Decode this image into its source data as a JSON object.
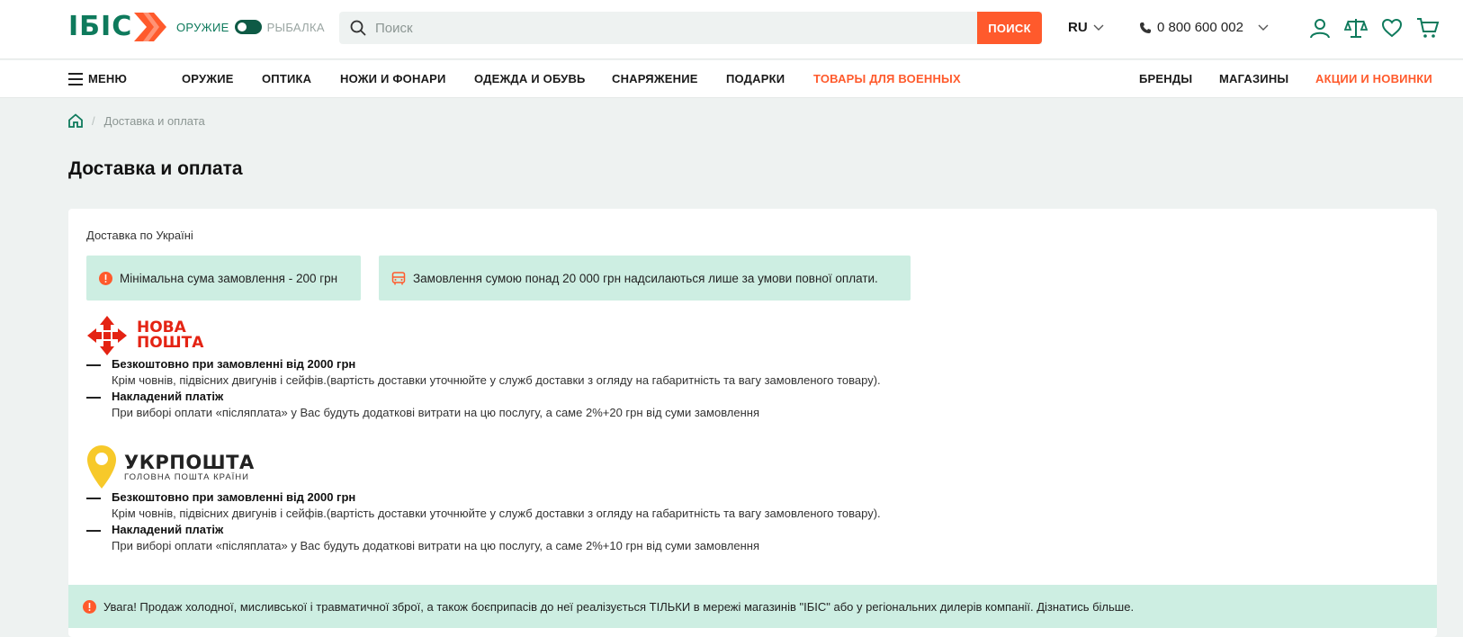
{
  "header": {
    "logo_text": "ІБІС",
    "switch_left": "ОРУЖИЕ",
    "switch_right": "РЫБАЛКА",
    "search_placeholder": "Поиск",
    "search_button": "ПОИСК",
    "language": "RU",
    "phone": "0 800 600 002",
    "accent_color": "#ff5a2c",
    "brand_color": "#0e7a5c"
  },
  "nav": {
    "menu": "МЕНЮ",
    "items": [
      "ОРУЖИЕ",
      "ОПТИКА",
      "НОЖИ И ФОНАРИ",
      "ОДЕЖДА И ОБУВЬ",
      "СНАРЯЖЕНИЕ",
      "ПОДАРКИ",
      "ТОВАРЫ ДЛЯ ВОЕННЫХ"
    ],
    "right_items": [
      "БРЕНДЫ",
      "МАГАЗИНЫ",
      "АКЦИИ И НОВИНКИ"
    ]
  },
  "breadcrumb": {
    "current": "Доставка и оплата"
  },
  "page": {
    "title": "Доставка и оплата",
    "section_label": "Доставка по Україні",
    "notes": [
      "Мінімальна сума замовлення - 200 грн",
      "Замовлення сумою понад 20 000 грн надсилаються лише за умови повної оплати."
    ],
    "nova_poshta": {
      "logo_line1": "НОВА",
      "logo_line2": "ПОШТА",
      "features": [
        {
          "title": "Безкоштовно при замовленні від 2000 грн",
          "desc": "Крім човнів, підвісних двигунів і сейфів.(вартість доставки уточнюйте у служб доставки з огляду на габаритність та вагу замовленого товару)."
        },
        {
          "title": "Накладений платіж",
          "desc": "При виборі оплати «післяплата» у Вас будуть додаткові витрати на цю послугу, а саме 2%+20 грн від суми замовлення"
        }
      ]
    },
    "ukrposhta": {
      "logo_title": "УКРПОШТА",
      "logo_sub": "ГОЛОВНА ПОШТА КРАЇНИ",
      "features": [
        {
          "title": "Безкоштовно при замовленні від 2000 грн",
          "desc": "Крім човнів, підвісних двигунів і сейфів.(вартість доставки уточнюйте у служб доставки з огляду на габаритність та вагу замовленого товару)."
        },
        {
          "title": "Накладений платіж",
          "desc": "При виборі оплати «післяплата» у Вас будуть додаткові витрати на цю послугу, а саме 2%+10 грн від суми замовлення"
        }
      ]
    },
    "warning": "Увага! Продаж холодної, мисливської і травматичної зброї, а також боєприпасів до неї реалізується ТІЛЬКИ в мережі магазинів \"ІБІС\" або у регіональних дилерів компанії. Дізнатись більше."
  }
}
